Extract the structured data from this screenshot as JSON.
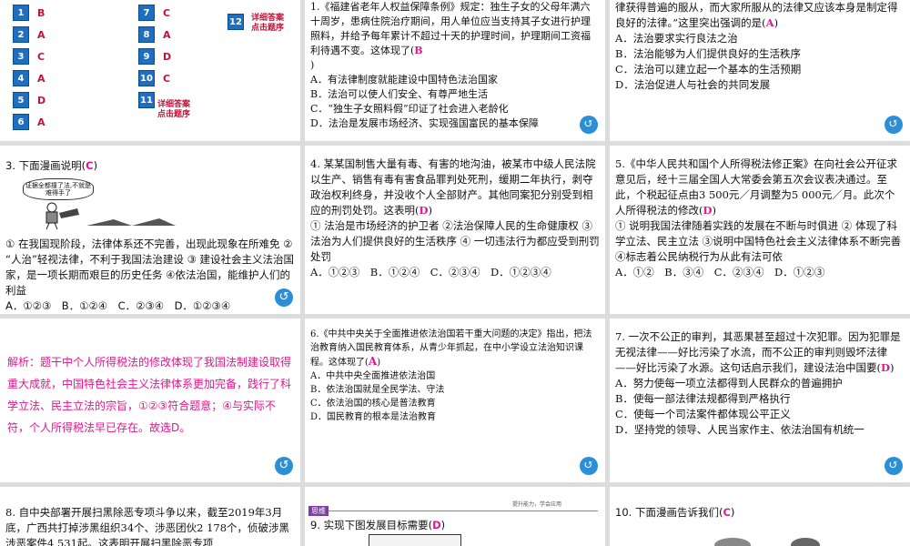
{
  "answer_key": {
    "items": [
      {
        "num": "1",
        "ans": "B"
      },
      {
        "num": "2",
        "ans": "A"
      },
      {
        "num": "3",
        "ans": "C"
      },
      {
        "num": "4",
        "ans": "A"
      },
      {
        "num": "5",
        "ans": "D"
      },
      {
        "num": "6",
        "ans": "A"
      },
      {
        "num": "7",
        "ans": "C"
      },
      {
        "num": "8",
        "ans": "A"
      },
      {
        "num": "9",
        "ans": "D"
      },
      {
        "num": "10",
        "ans": "C"
      },
      {
        "num": "11",
        "ans": ""
      },
      {
        "num": "12",
        "ans": ""
      }
    ],
    "detail_link": "详细答案\n点击题序"
  },
  "q1": {
    "stem": "1.《福建省老年人权益保障条例》规定：独生子女的父母年满六十周岁，患病住院治疗期间，用人单位应当支持其子女进行护理照料，并给予每年累计不超过十天的护理时间，护理期间工资福利待遇不变。这体现了(",
    "answer": "B",
    "close": ")",
    "options": [
      "A．有法律制度就能建设中国特色法治国家",
      "B．法治可以使人们安全、有尊严地生活",
      "C．“独生子女照料假”印证了社会进入老龄化",
      "D．法治是发展市场经济、实现强国富民的基本保障"
    ]
  },
  "q2": {
    "stem": "律获得普遍的服从，而大家所服从的法律又应该本身是制定得良好的法律。”这里突出强调的是(",
    "answer": "A",
    "close": ")",
    "options": [
      "A．法治要求实行良法之治",
      "B．法治能够为人们提供良好的生活秩序",
      "C．法治可以建立起一个基本的生活预期",
      "D．法治促进人与社会的共同发展"
    ]
  },
  "q3": {
    "stem": "3. 下面漫画说明(",
    "answer": "C",
    "close": ")",
    "bubble": "证据全都撞了法,不就是难得手了",
    "body": "① 在我国现阶段，法律体系还不完善，出现此现象在所难免 ② “人治”轻视法律，不利于我国法治建设 ③ 建设社会主义法治国家，是一项长期而艰巨的历史任务 ④依法治国，能维护人们的利益",
    "options": "A．①②③　B．①②④　C．②③④　D．①②③④"
  },
  "q4": {
    "stem": "4. 某某国制售大量有毒、有害的地沟油，被某市中级人民法院以生产、销售有毒有害食品罪判处死刑，缓期二年执行，剥夺政治权利终身，并没收个人全部财产。其他同案犯分别受到相应的刑罚处罚。这表明(",
    "answer": "D",
    "close": ")",
    "body": "① 法治是市场经济的护卫者 ②法治保障人民的生命健康权 ③法治为人们提供良好的生活秩序 ④ 一切违法行为都应受到刑罚处罚",
    "options": "A．①②③　B．①②④　C．②③④　D．①②③④"
  },
  "q5": {
    "stem": "5.《中华人民共和国个人所得税法修正案》在向社会公开征求意见后，经十三届全国人大常委会第五次会议表决通过。至此，个税起征点由3 500元／月调整为5 000元／月。此次个人所得税法的修改(",
    "answer": "D",
    "close": ")",
    "body": "① 说明我国法律随着实践的发展在不断与时俱进 ② 体现了科学立法、民主立法 ③说明中国特色社会主义法律体系不断完善 ④标志着公民纳税行为从此有法可依",
    "options": "A．①②　B．③④　C．②③④　D．①②③"
  },
  "analysis": "解析：题干中个人所得税法的修改体现了我国法制建设取得重大成就，中国特色社会主义法律体系更加完备，践行了科学立法、民主立法的宗旨，①②③符合题意；④与实际不符，个人所得税法早已存在。故选D。",
  "q6": {
    "stem": "6.《中共中央关于全面推进依法治国若干重大问题的决定》指出，把法治教育纳入国民教育体系，从青少年抓起，在中小学设立法治知识课程。这体现了(",
    "answer": "A",
    "close": ")",
    "options": [
      "A．中共中央全面推进依法治国",
      "B．依法治国就是全民学法、守法",
      "C．依法治国的核心是普法教育",
      "D．国民教育的根本是法治教育"
    ]
  },
  "q7": {
    "stem": "7. 一次不公正的审判，其恶果甚至超过十次犯罪。因为犯罪是无视法律——好比污染了水流，而不公正的审判则毁坏法律——好比污染了水源。这句话启示我们，建设法治中国要(",
    "answer": "D",
    "close": ")",
    "options": [
      "A．努力使每一项立法都得到人民群众的普遍拥护",
      "B．使每一部法律法规都得到严格执行",
      "C．使每一个司法案件都体现公平正义",
      "D．坚持党的领导、人民当家作主、依法治国有机统一"
    ]
  },
  "q8": {
    "stem": "8. 自中央部署开展扫黑除恶专项斗争以来，截至2019年3月底，广西共打掉涉黑组织34个、涉恶团伙2 178个，侦破涉黑涉恶案件4 531起。这表明开展扫黑除恶专项"
  },
  "q9": {
    "header_badge": "思维",
    "header_tag": "提升能力，学会应用",
    "stem": "9. 实现下图发展目标需要(",
    "answer": "D",
    "close": ")"
  },
  "q10": {
    "stem": "10. 下面漫画告诉我们(",
    "answer": "C",
    "close": ")"
  },
  "back_icon": "↺"
}
